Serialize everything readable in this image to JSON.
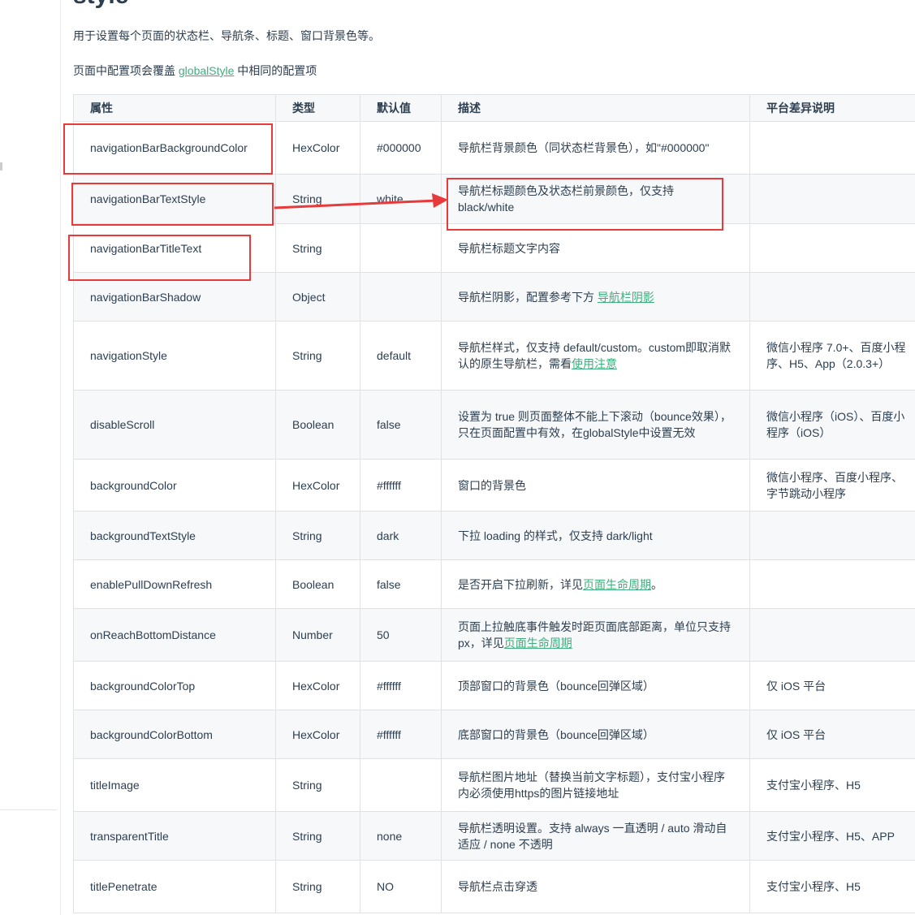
{
  "heading": "style",
  "intro": {
    "line1": "用于设置每个页面的状态栏、导航条、标题、窗口背景色等。",
    "line2_pre": "页面中配置项会覆盖 ",
    "line2_link": "globalStyle",
    "line2_post": " 中相同的配置项"
  },
  "table": {
    "headers": [
      "属性",
      "类型",
      "默认值",
      "描述",
      "平台差异说明"
    ],
    "rows": [
      {
        "prop": "navigationBarBackgroundColor",
        "type": "HexColor",
        "default": "#000000",
        "desc": "导航栏背景颜色（同状态栏背景色），如\"#000000\"",
        "platform": ""
      },
      {
        "prop": "navigationBarTextStyle",
        "type": "String",
        "default": "white",
        "desc": "导航栏标题颜色及状态栏前景颜色，仅支持 black/white",
        "platform": ""
      },
      {
        "prop": "navigationBarTitleText",
        "type": "String",
        "default": "",
        "desc": "导航栏标题文字内容",
        "platform": ""
      },
      {
        "prop": "navigationBarShadow",
        "type": "Object",
        "default": "",
        "desc": "导航栏阴影，配置参考下方 ",
        "desc_link": "导航栏阴影",
        "platform": ""
      },
      {
        "prop": "navigationStyle",
        "type": "String",
        "default": "default",
        "desc": "导航栏样式，仅支持 default/custom。custom即取消默认的原生导航栏，需看",
        "desc_link": "使用注意",
        "platform": "微信小程序 7.0+、百度小程序、H5、App（2.0.3+）"
      },
      {
        "prop": "disableScroll",
        "type": "Boolean",
        "default": "false",
        "desc": "设置为 true 则页面整体不能上下滚动（bounce效果），只在页面配置中有效，在globalStyle中设置无效",
        "platform": "微信小程序（iOS）、百度小程序（iOS）"
      },
      {
        "prop": "backgroundColor",
        "type": "HexColor",
        "default": "#ffffff",
        "desc": "窗口的背景色",
        "platform": "微信小程序、百度小程序、字节跳动小程序"
      },
      {
        "prop": "backgroundTextStyle",
        "type": "String",
        "default": "dark",
        "desc": "下拉 loading 的样式，仅支持 dark/light",
        "platform": ""
      },
      {
        "prop": "enablePullDownRefresh",
        "type": "Boolean",
        "default": "false",
        "desc": "是否开启下拉刷新，详见",
        "desc_link": "页面生命周期",
        "desc_post": "。",
        "platform": ""
      },
      {
        "prop": "onReachBottomDistance",
        "type": "Number",
        "default": "50",
        "desc": "页面上拉触底事件触发时距页面底部距离，单位只支持px，详见",
        "desc_link": "页面生命周期",
        "platform": ""
      },
      {
        "prop": "backgroundColorTop",
        "type": "HexColor",
        "default": "#ffffff",
        "desc": "顶部窗口的背景色（bounce回弹区域）",
        "platform": "仅 iOS 平台"
      },
      {
        "prop": "backgroundColorBottom",
        "type": "HexColor",
        "default": "#ffffff",
        "desc": "底部窗口的背景色（bounce回弹区域）",
        "platform": "仅 iOS 平台"
      },
      {
        "prop": "titleImage",
        "type": "String",
        "default": "",
        "desc": "导航栏图片地址（替换当前文字标题），支付宝小程序内必须使用https的图片链接地址",
        "platform": "支付宝小程序、H5"
      },
      {
        "prop": "transparentTitle",
        "type": "String",
        "default": "none",
        "desc": "导航栏透明设置。支持 always 一直透明 / auto 滑动自适应 / none 不透明",
        "platform": "支付宝小程序、H5、APP"
      },
      {
        "prop": "titlePenetrate",
        "type": "String",
        "default": "NO",
        "desc": "导航栏点击穿透",
        "platform": "支付宝小程序、H5"
      }
    ]
  },
  "colors": {
    "accent_link": "#3eaf7c",
    "annotation_red": "#e83a3a",
    "text": "#2c3e50",
    "border": "#dfe2e5",
    "stripe": "#f6f8fa"
  }
}
